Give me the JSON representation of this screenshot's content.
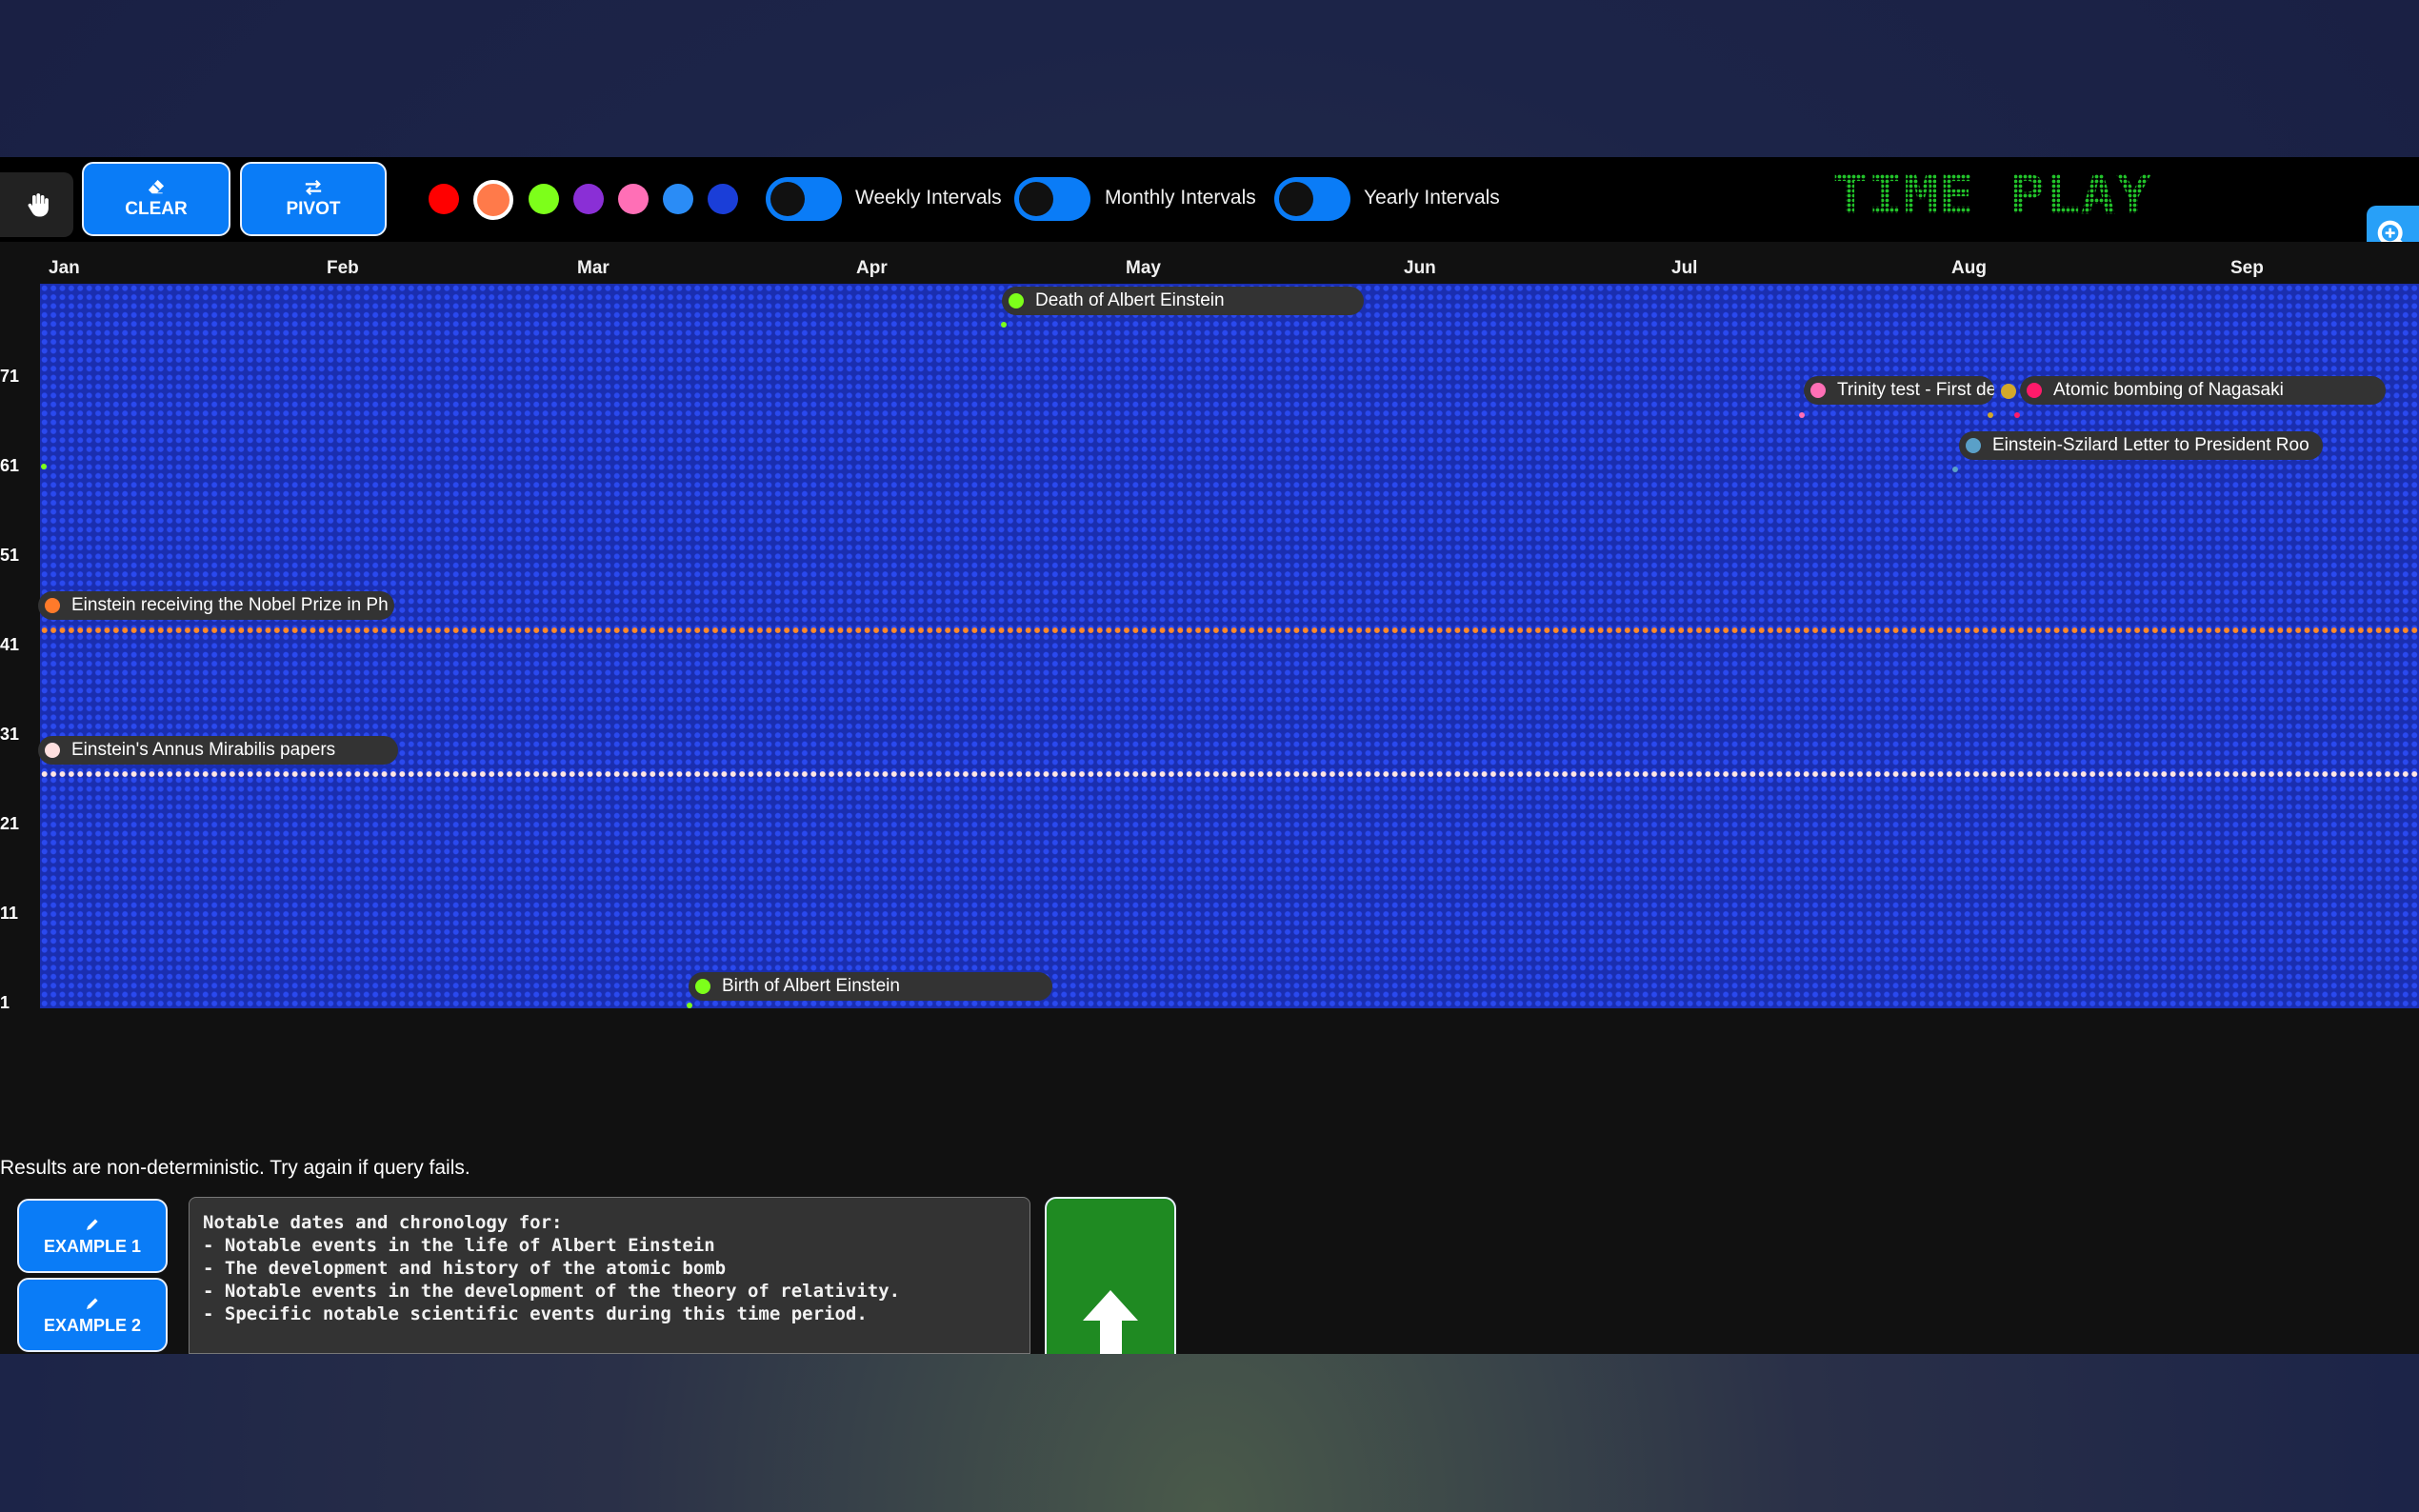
{
  "toolbar": {
    "pan_icon": "hand-pointer-icon",
    "clear_label": "CLEAR",
    "clear_icon": "eraser-icon",
    "pivot_label": "PIVOT",
    "pivot_icon": "swap-arrows-icon",
    "swatches": [
      "#ff0000",
      "#ff7a4a",
      "#7dff1a",
      "#8a2fd6",
      "#ff6fb6",
      "#2a8cf6",
      "#1a3ed8"
    ],
    "selected_swatch": "#ff7a4a",
    "weekly_label": "Weekly Intervals",
    "monthly_label": "Monthly Intervals",
    "yearly_label": "Yearly Intervals",
    "logo_text": "TIME PLAY",
    "search_icon": "magnifier-icon"
  },
  "months": [
    "Jan",
    "Feb",
    "Mar",
    "Apr",
    "May",
    "Jun",
    "Jul",
    "Aug",
    "Sep"
  ],
  "y_labels": [
    "71",
    "61",
    "51",
    "41",
    "31",
    "21",
    "11",
    "1"
  ],
  "highlight_colors": {
    "orange_row": "#ff8a2a",
    "white_row": "#ffe6e6"
  },
  "events": [
    {
      "label": "Death of Albert Einstein",
      "color": "#7dff1a"
    },
    {
      "label": "Trinity test - First de",
      "color": "#ff6fb6"
    },
    {
      "label": "Atomic bombing of Nagasaki",
      "color": "#ff1a6a"
    },
    {
      "label": "Einstein-Szilard Letter to President Roo",
      "color": "#5aa0c8"
    },
    {
      "label": "Einstein receiving the Nobel Prize in Ph",
      "color": "#ff7a2a"
    },
    {
      "label": "Einstein's Annus Mirabilis papers",
      "color": "#ffe0e0"
    },
    {
      "label": "Birth of Albert Einstein",
      "color": "#7dff1a"
    }
  ],
  "extra_bullet_color": "#d4a82a",
  "notice": "Results are non-deterministic. Try again if query fails.",
  "examples": {
    "ex1_label": "EXAMPLE 1",
    "ex2_label": "EXAMPLE 2",
    "icon": "pencil-icon"
  },
  "query_text": "Notable dates and chronology for:\n- Notable events in the life of Albert Einstein\n- The development and history of the atomic bomb\n- Notable events in the development of the theory of relativity.\n- Specific notable scientific events during this time period.",
  "submit_icon": "arrow-up-icon"
}
